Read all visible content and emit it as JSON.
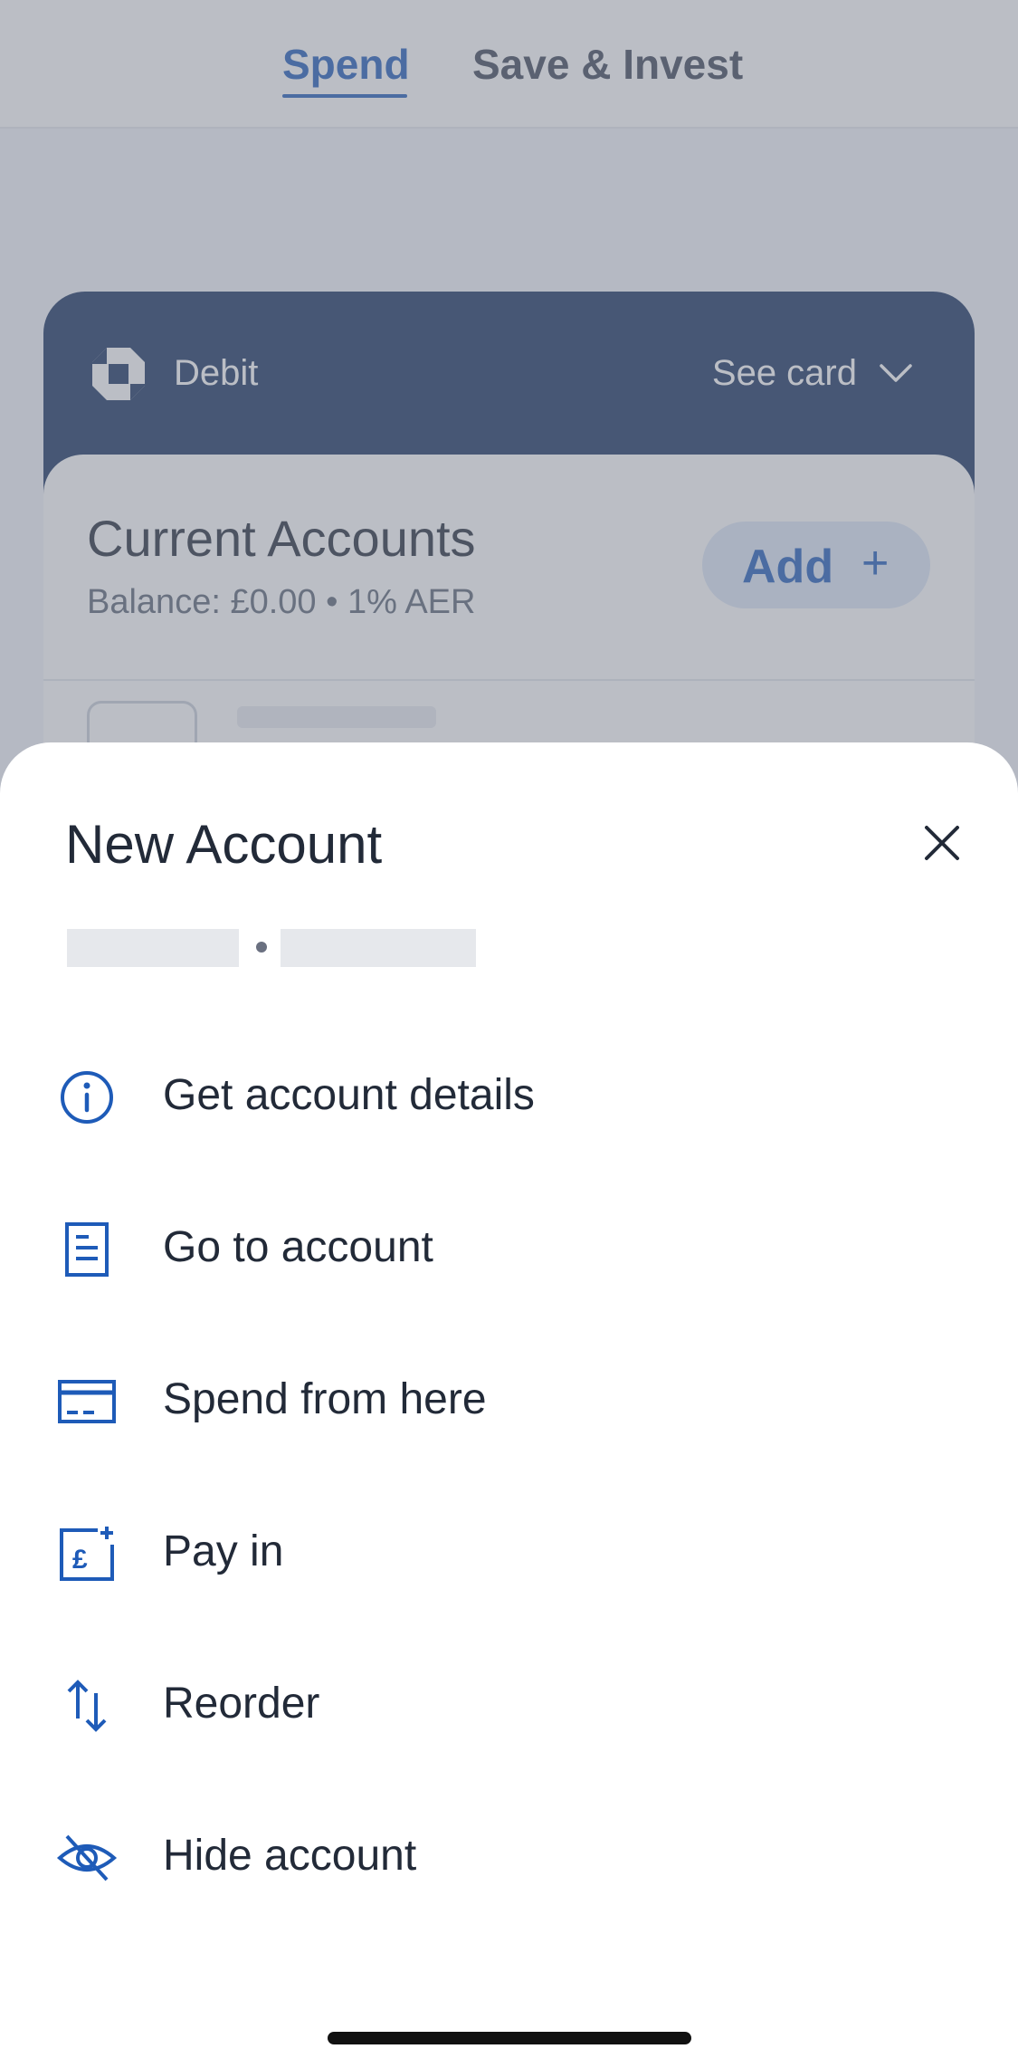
{
  "tabs": [
    {
      "label": "Spend",
      "active": true
    },
    {
      "label": "Save & Invest",
      "active": false
    }
  ],
  "card": {
    "type": "Debit",
    "see_card": "See card",
    "logo_icon": "bank-octagon-logo",
    "chevron_icon": "chevron-down-icon",
    "color": "#16305f"
  },
  "accounts": {
    "title": "Current Accounts",
    "balance": "Balance: £0.00 • 1% AER",
    "add_label": "Add",
    "add_symbol": "+"
  },
  "sheet": {
    "title": "New Account",
    "close_icon": "close-icon",
    "items": [
      {
        "label": "Get account details",
        "icon": "info-icon"
      },
      {
        "label": "Go to account",
        "icon": "document-icon"
      },
      {
        "label": "Spend from here",
        "icon": "card-icon"
      },
      {
        "label": "Pay in",
        "icon": "pay-in-icon"
      },
      {
        "label": "Reorder",
        "icon": "reorder-arrows-icon"
      },
      {
        "label": "Hide account",
        "icon": "eye-off-icon"
      }
    ]
  },
  "colors": {
    "accent": "#1e5bb8",
    "text": "#222a38",
    "card": "#16305f"
  }
}
